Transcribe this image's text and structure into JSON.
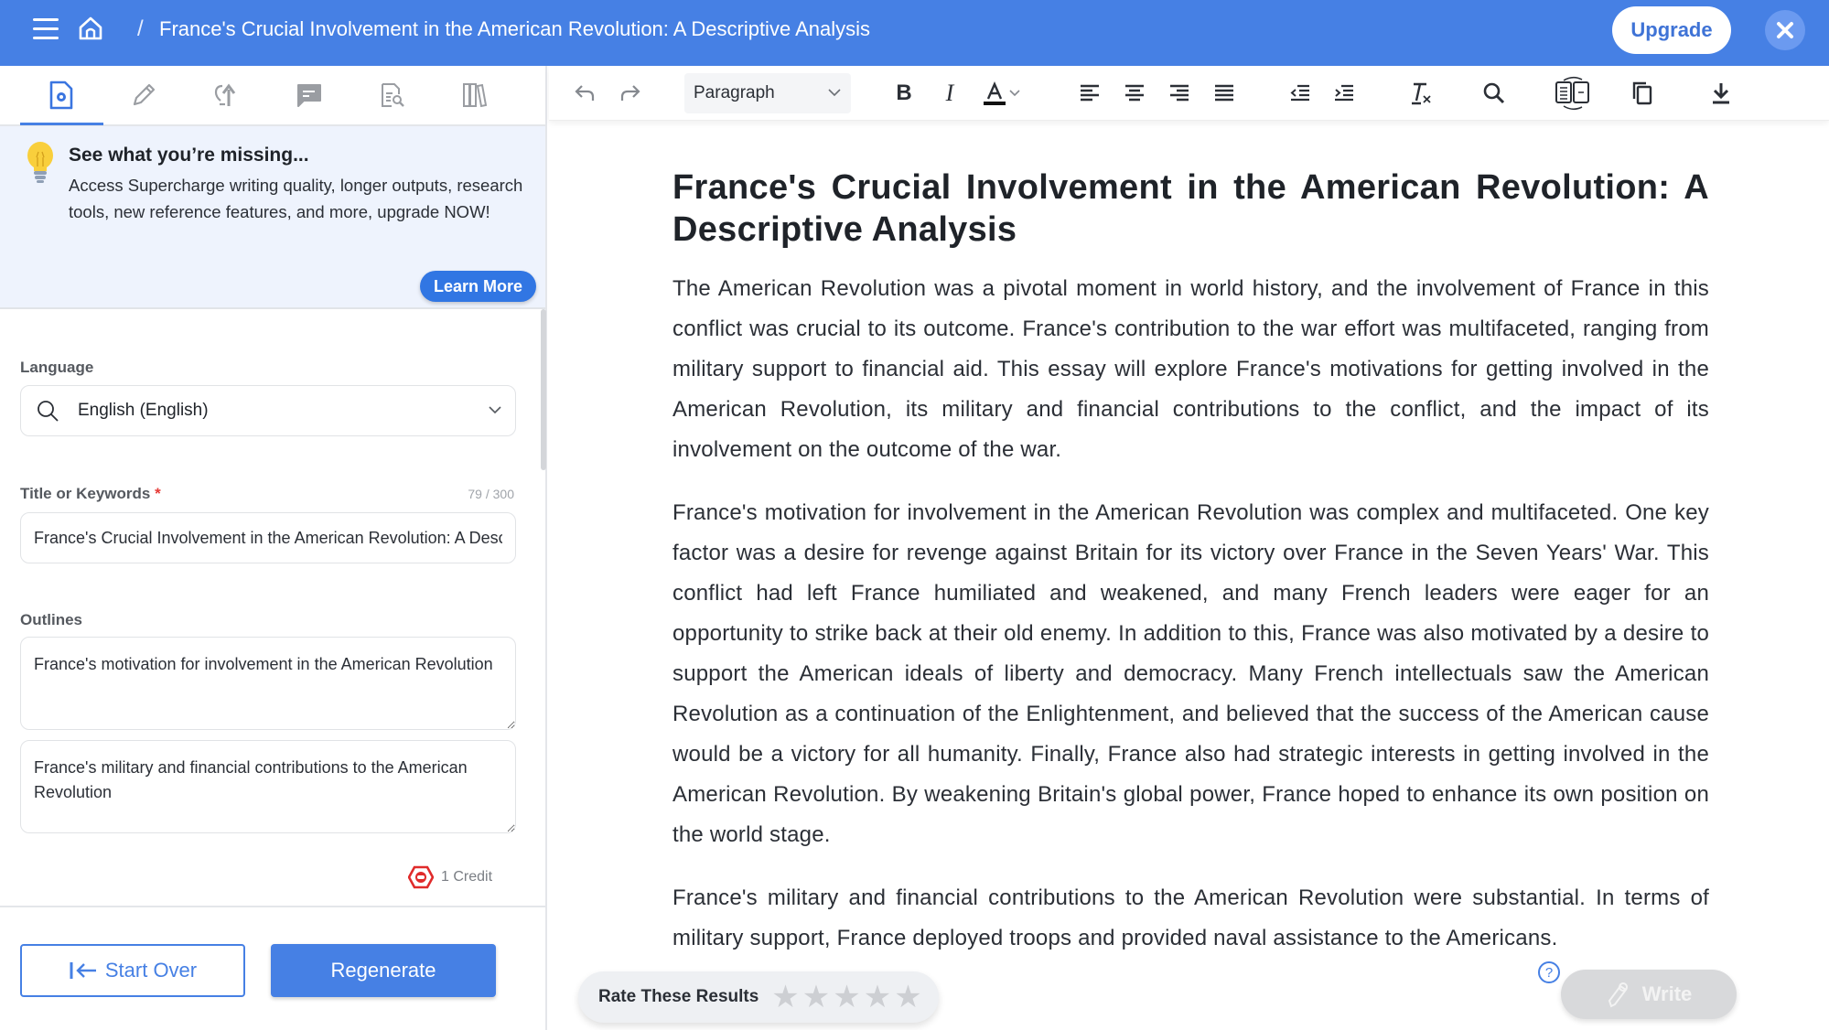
{
  "header": {
    "breadcrumb_separator": "/",
    "title": "France's Crucial Involvement in the American Revolution: A Descriptive Analysis",
    "upgrade_label": "Upgrade",
    "menu_icon": "hamburger-icon",
    "home_icon": "home-icon",
    "close_icon": "close-icon",
    "brand_color": "#4680E4"
  },
  "left_panel": {
    "tabs": [
      {
        "name": "document-settings",
        "icon": "document-gear-icon",
        "active": true
      },
      {
        "name": "edit",
        "icon": "pencil-icon",
        "active": false
      },
      {
        "name": "ideas",
        "icon": "lightbulb-arrow-icon",
        "active": false
      },
      {
        "name": "chat",
        "icon": "chat-bubble-icon",
        "active": false
      },
      {
        "name": "review",
        "icon": "document-search-icon",
        "active": false
      },
      {
        "name": "library",
        "icon": "books-icon",
        "active": false
      }
    ],
    "promo": {
      "title": "See what you’re missing...",
      "body": "Access Supercharge writing quality, longer outputs, research tools, new reference features, and more, upgrade NOW!",
      "button_label": "Learn More"
    },
    "language": {
      "label": "Language",
      "value": "English (English)"
    },
    "title_field": {
      "label": "Title or Keywords",
      "required_marker": "*",
      "counter": "79 / 300",
      "value": "France's Crucial Involvement in the American Revolution: A Descriptive Analysis"
    },
    "outlines": {
      "label": "Outlines",
      "items": [
        "France's motivation for involvement in the American Revolution",
        "France's military and financial contributions to the American Revolution"
      ]
    },
    "credit": "1 Credit",
    "start_over_label": "Start Over",
    "regenerate_label": "Regenerate"
  },
  "editor": {
    "toolbar": {
      "block_format": "Paragraph",
      "buttons": [
        "undo",
        "redo",
        "bold",
        "italic",
        "text-color",
        "align-left",
        "align-center",
        "align-right",
        "align-justify",
        "outdent",
        "indent",
        "clear-formatting",
        "search",
        "compare",
        "copy",
        "download"
      ]
    },
    "document": {
      "title": "France's Crucial Involvement in the American Revolution: A Descriptive Analysis",
      "paragraphs": [
        "The American Revolution was a pivotal moment in world history, and the involvement of France in this conflict was crucial to its outcome. France's contribution to the war effort was multifaceted, ranging from military support to financial aid. This essay will explore France's motivations for getting involved in the American Revolution, its military and financial contributions to the conflict, and the impact of its involvement on the outcome of the war.",
        "France's motivation for involvement in the American Revolution was complex and multifaceted. One key factor was a desire for revenge against Britain for its victory over France in the Seven Years' War. This conflict had left France humiliated and weakened, and many French leaders were eager for an opportunity to strike back at their old enemy. In addition to this, France was also motivated by a desire to support the American ideals of liberty and democracy. Many French intellectuals saw the American Revolution as a continuation of the Enlightenment, and believed that the success of the American cause would be a victory for all humanity. Finally, France also had strategic interests in getting involved in the American Revolution. By weakening Britain's global power, France hoped to enhance its own position on the world stage.",
        "France's military and financial contributions to the American Revolution were substantial. In terms of military support, France deployed troops and provided naval assistance to the Americans."
      ]
    },
    "rating": {
      "label": "Rate These Results",
      "max_stars": 5,
      "selected": 0
    },
    "help_label": "?",
    "write_label": "Write"
  }
}
